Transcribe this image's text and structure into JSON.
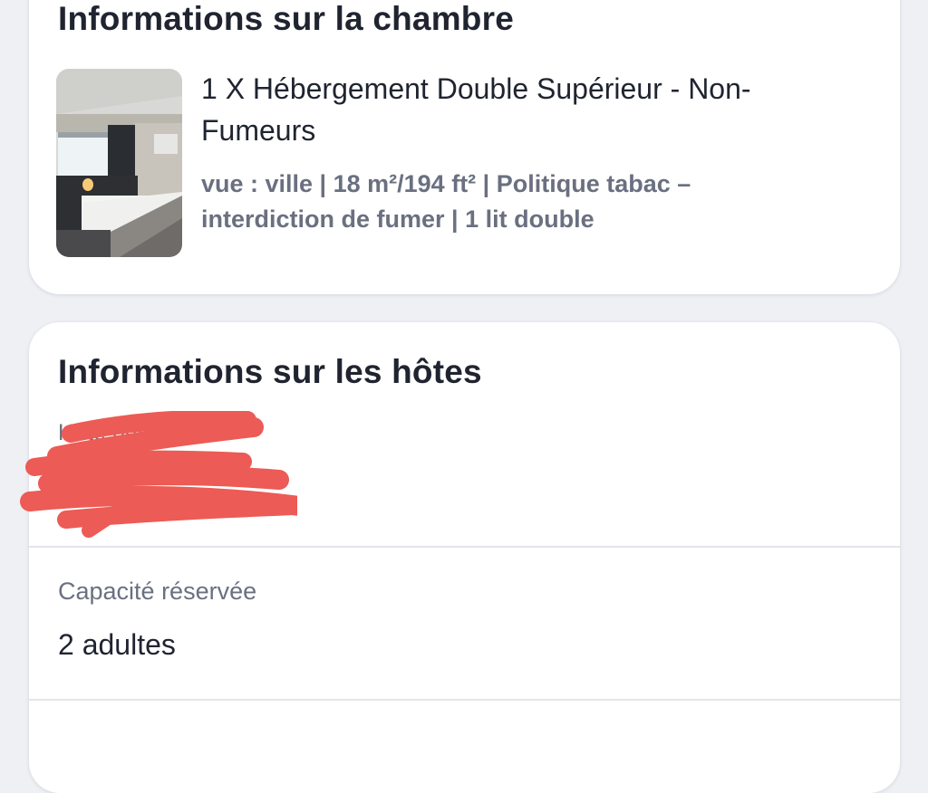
{
  "room_section": {
    "title": "Informations sur la chambre",
    "room_name": "1 X Hébergement Double Supérieur - Non-Fumeurs",
    "room_details": "vue : ville | 18 m²/194 ft² | Politique tabac – interdiction de fumer | 1 lit double"
  },
  "guests_section": {
    "title": "Informations sur les hôtes",
    "main_guest_label": "Hôte principal",
    "main_guest_value": "",
    "capacity_label": "Capacité réservée",
    "capacity_value": "2 adultes"
  },
  "colors": {
    "background": "#eef0f4",
    "card": "#ffffff",
    "text_primary": "#1f2430",
    "text_secondary": "#6a7080",
    "redaction": "#ec5b55"
  }
}
